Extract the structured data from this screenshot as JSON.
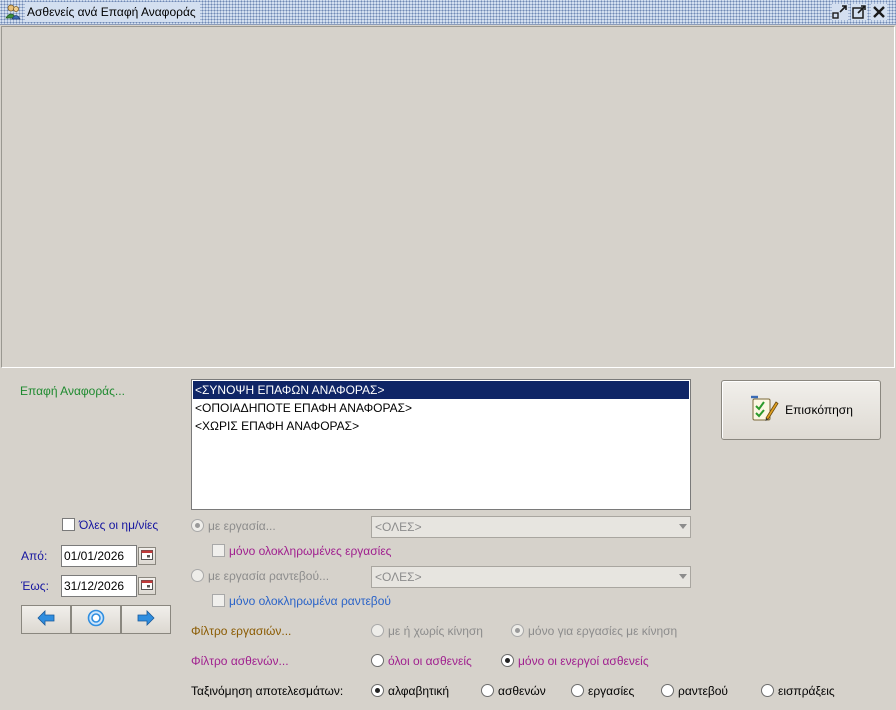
{
  "window": {
    "title": "Ασθενείς ανά Επαφή Αναφοράς",
    "icons": [
      "user-group-icon",
      "restore-icon",
      "maximize-icon",
      "close-icon"
    ]
  },
  "contact": {
    "label": "Επαφή Αναφοράς...",
    "items": [
      "<ΣΥΝΟΨΗ ΕΠΑΦΩΝ ΑΝΑΦΟΡΑΣ>",
      "<ΟΠΟΙΑΔΗΠΟΤΕ ΕΠΑΦΗ ΑΝΑΦΟΡΑΣ>",
      "<ΧΩΡΙΣ ΕΠΑΦΗ ΑΝΑΦΟΡΑΣ>"
    ],
    "selected_index": 0
  },
  "preview": {
    "label": "Επισκόπηση",
    "icon": "checklist-pen-icon"
  },
  "dates": {
    "all_label": "Όλες οι ημ/νίες",
    "from_label": "Από:",
    "from_value": "01/01/2026",
    "to_label": "Έως:",
    "to_value": "31/12/2026",
    "nav_icons": [
      "arrow-left-icon",
      "target-icon",
      "arrow-right-icon"
    ]
  },
  "filters": {
    "with_work_label": "με εργασία...",
    "with_work_combo": "<ΟΛΕΣ>",
    "completed_works_label": "μόνο ολοκληρωμένες εργασίες",
    "with_appt_work_label": "με εργασία ραντεβού...",
    "with_appt_work_combo": "<ΟΛΕΣ>",
    "completed_appts_label": "μόνο ολοκληρωμένα ραντεβού"
  },
  "work_filter": {
    "label": "Φίλτρο εργασιών...",
    "options": [
      "με ή χωρίς κίνηση",
      "μόνο για εργασίες με κίνηση"
    ],
    "selected_index": 1
  },
  "patient_filter": {
    "label": "Φίλτρο ασθενών...",
    "options": [
      "όλοι οι ασθενείς",
      "μόνο οι ενεργοί ασθενείς"
    ],
    "selected_index": 1
  },
  "sort": {
    "label": "Ταξινόμηση αποτελεσμάτων:",
    "options": [
      "αλφαβητική",
      "ασθενών",
      "εργασίες",
      "ραντεβού",
      "εισπράξεις"
    ],
    "selected_index": 0
  },
  "colors": {
    "background": "#d6d2cb",
    "selection": "#0f2566",
    "green_label": "#1e8a2f",
    "purple_label": "#a0208f",
    "blue_label": "#1515a0"
  }
}
